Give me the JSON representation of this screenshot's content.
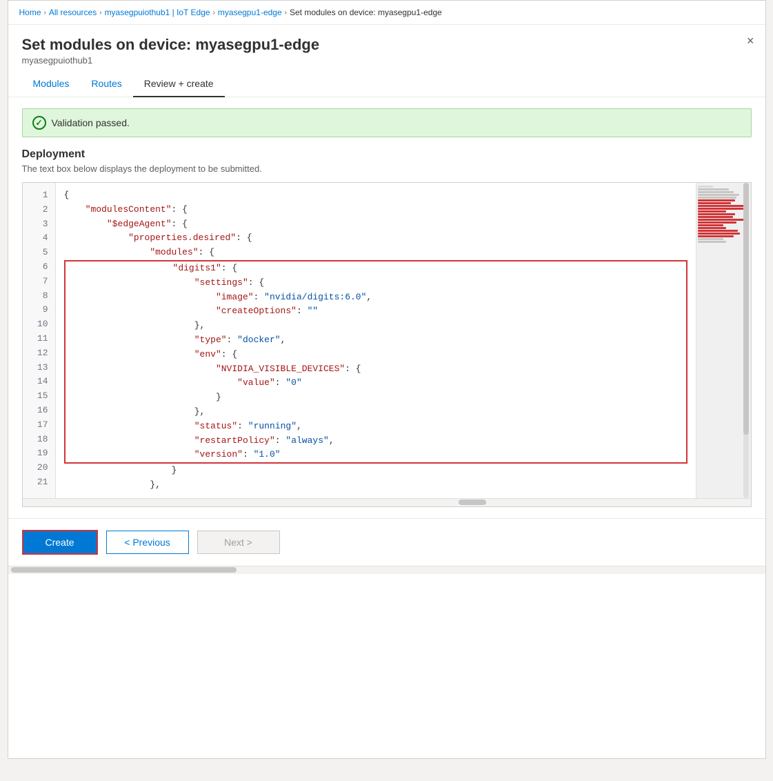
{
  "breadcrumb": {
    "items": [
      {
        "label": "Home",
        "link": true
      },
      {
        "label": "All resources",
        "link": true
      },
      {
        "label": "myasegpuiothub1 | IoT Edge",
        "link": true
      },
      {
        "label": "myasegpu1-edge",
        "link": true
      },
      {
        "label": "Set modules on device: myasegpu1-edge",
        "link": false
      }
    ]
  },
  "header": {
    "title": "Set modules on device: myasegpu1-edge",
    "subtitle": "myasegpuiothub1",
    "close_label": "×"
  },
  "tabs": [
    {
      "label": "Modules",
      "active": false
    },
    {
      "label": "Routes",
      "active": false
    },
    {
      "label": "Review + create",
      "active": true
    }
  ],
  "validation": {
    "message": "Validation passed."
  },
  "deployment": {
    "title": "Deployment",
    "description": "The text box below displays the deployment to be submitted."
  },
  "code": {
    "lines": [
      {
        "num": 1,
        "content": "{"
      },
      {
        "num": 2,
        "content": "    \"modulesContent\": {"
      },
      {
        "num": 3,
        "content": "        \"$edgeAgent\": {"
      },
      {
        "num": 4,
        "content": "            \"properties.desired\": {"
      },
      {
        "num": 5,
        "content": "                \"modules\": {"
      },
      {
        "num": 6,
        "content": "                    \"digits1\": {"
      },
      {
        "num": 7,
        "content": "                        \"settings\": {"
      },
      {
        "num": 8,
        "content": "                            \"image\": \"nvidia/digits:6.0\","
      },
      {
        "num": 9,
        "content": "                            \"createOptions\": \"\""
      },
      {
        "num": 10,
        "content": "                        },"
      },
      {
        "num": 11,
        "content": "                        \"type\": \"docker\","
      },
      {
        "num": 12,
        "content": "                        \"env\": {"
      },
      {
        "num": 13,
        "content": "                            \"NVIDIA_VISIBLE_DEVICES\": {"
      },
      {
        "num": 14,
        "content": "                                \"value\": \"0\""
      },
      {
        "num": 15,
        "content": "                            }"
      },
      {
        "num": 16,
        "content": "                        },"
      },
      {
        "num": 17,
        "content": "                        \"status\": \"running\","
      },
      {
        "num": 18,
        "content": "                        \"restartPolicy\": \"always\","
      },
      {
        "num": 19,
        "content": "                        \"version\": \"1.0\""
      },
      {
        "num": 20,
        "content": "                    }"
      },
      {
        "num": 21,
        "content": "                },"
      }
    ]
  },
  "buttons": {
    "create": "Create",
    "previous": "< Previous",
    "next": "Next >"
  }
}
